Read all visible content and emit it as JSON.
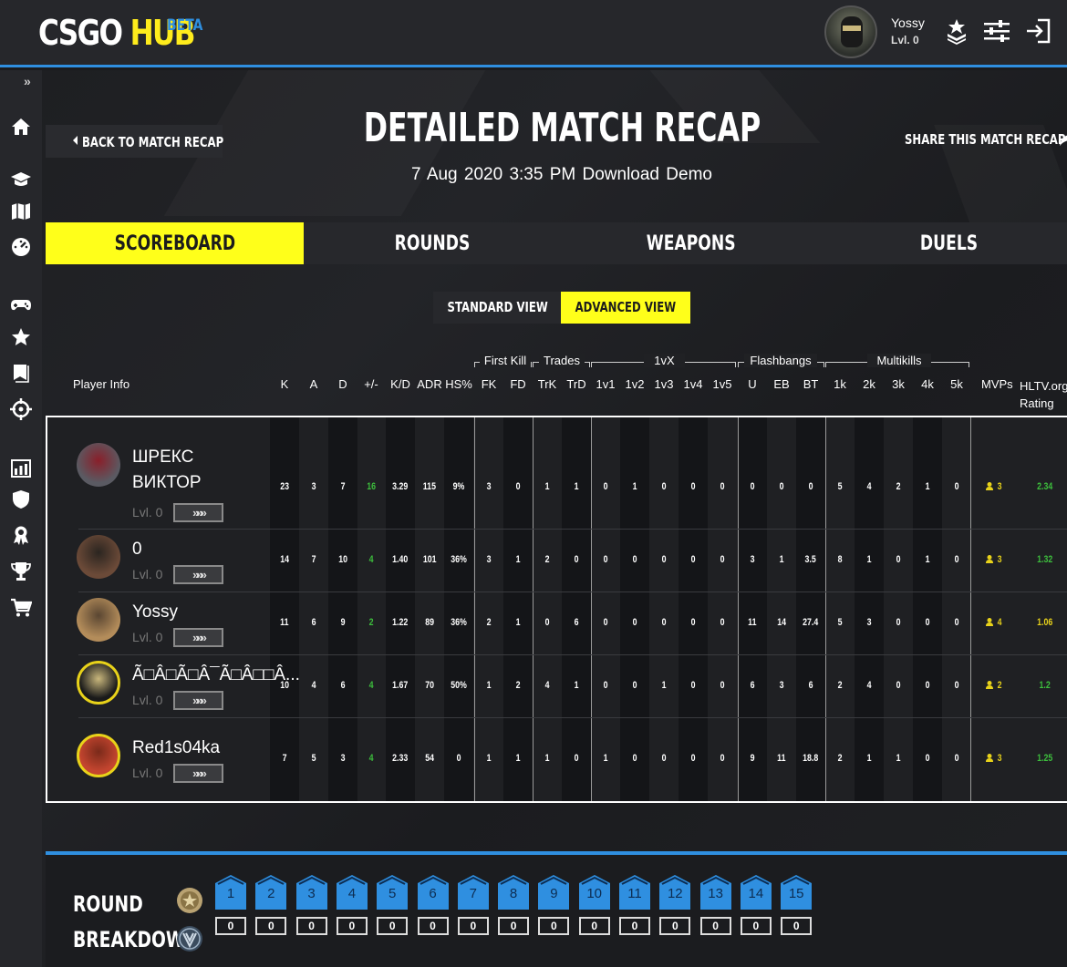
{
  "header": {
    "logo_main": "CSGO",
    "logo_hub": "HUB",
    "logo_badge": "BETA",
    "user_name": "Yossy",
    "user_level": "Lvl. 0"
  },
  "page": {
    "back_label": "BACK TO MATCH RECAP",
    "title": "DETAILED MATCH RECAP",
    "date": "7 Aug 2020",
    "time": "3:35 PM",
    "download_label": "Download Demo",
    "share_label": "SHARE THIS MATCH RECAP"
  },
  "tabs": [
    {
      "label": "SCOREBOARD",
      "active": true
    },
    {
      "label": "ROUNDS",
      "active": false
    },
    {
      "label": "WEAPONS",
      "active": false
    },
    {
      "label": "DUELS",
      "active": false
    }
  ],
  "views": {
    "standard": "STANDARD VIEW",
    "advanced": "ADVANCED VIEW",
    "selected": "advanced"
  },
  "table": {
    "player_info_label": "Player Info",
    "groups": [
      "First Kill",
      "Trades",
      "1vX",
      "Flashbangs",
      "Multikills"
    ],
    "columns": [
      "K",
      "A",
      "D",
      "+/-",
      "K/D",
      "ADR",
      "HS%",
      "FK",
      "FD",
      "TrK",
      "TrD",
      "1v1",
      "1v2",
      "1v3",
      "1v4",
      "1v5",
      "U",
      "EB",
      "BT",
      "1k",
      "2k",
      "3k",
      "4k",
      "5k",
      "MVPs",
      "HLTV.org Rating"
    ],
    "rows": [
      {
        "name": "ШРЕКС ВИКТОР",
        "level": "Lvl. 0",
        "rank": "»»»",
        "stats": [
          "23",
          "3",
          "7",
          "16",
          "3.29",
          "115",
          "9%",
          "3",
          "0",
          "1",
          "1",
          "0",
          "1",
          "0",
          "0",
          "0",
          "0",
          "0",
          "0",
          "5",
          "4",
          "2",
          "1",
          "0",
          "3",
          "2.34"
        ]
      },
      {
        "name": "0",
        "level": "Lvl. 0",
        "rank": "»»»",
        "stats": [
          "14",
          "7",
          "10",
          "4",
          "1.40",
          "101",
          "36%",
          "3",
          "1",
          "2",
          "0",
          "0",
          "0",
          "0",
          "0",
          "0",
          "3",
          "1",
          "3.5",
          "8",
          "1",
          "0",
          "1",
          "0",
          "3",
          "1.32"
        ]
      },
      {
        "name": "Yossy",
        "level": "Lvl. 0",
        "rank": "»»»",
        "stats": [
          "11",
          "6",
          "9",
          "2",
          "1.22",
          "89",
          "36%",
          "2",
          "1",
          "0",
          "6",
          "0",
          "0",
          "0",
          "0",
          "0",
          "11",
          "14",
          "27.4",
          "5",
          "3",
          "0",
          "0",
          "0",
          "4",
          "1.06"
        ]
      },
      {
        "name": "Ã□Â□Ã□Â¯Ã□Â□□Â...",
        "level": "Lvl. 0",
        "rank": "»»»",
        "stats": [
          "10",
          "4",
          "6",
          "4",
          "1.67",
          "70",
          "50%",
          "1",
          "2",
          "4",
          "1",
          "0",
          "0",
          "1",
          "0",
          "0",
          "6",
          "3",
          "6",
          "2",
          "4",
          "0",
          "0",
          "0",
          "2",
          "1.2"
        ]
      },
      {
        "name": "Red1s04ka",
        "level": "Lvl. 0",
        "rank": "»»»",
        "stats": [
          "7",
          "5",
          "3",
          "4",
          "2.33",
          "54",
          "0",
          "1",
          "1",
          "1",
          "0",
          "1",
          "0",
          "0",
          "0",
          "0",
          "9",
          "11",
          "18.8",
          "2",
          "1",
          "1",
          "0",
          "0",
          "3",
          "1.25"
        ]
      }
    ]
  },
  "round_breakdown": {
    "title_line1": "ROUND",
    "title_line2": "BREAKDOWN",
    "rounds": [
      "1",
      "2",
      "3",
      "4",
      "5",
      "6",
      "7",
      "8",
      "9",
      "10",
      "11",
      "12",
      "13",
      "14",
      "15"
    ],
    "scores": [
      "0",
      "0",
      "0",
      "0",
      "0",
      "0",
      "0",
      "0",
      "0",
      "0",
      "0",
      "0",
      "0",
      "0",
      "0"
    ]
  },
  "colors": {
    "accent_yellow": "#ffff1a",
    "accent_blue": "#2f8fe0",
    "positive_green": "#3dbf3d",
    "gold": "#e8d21a"
  }
}
